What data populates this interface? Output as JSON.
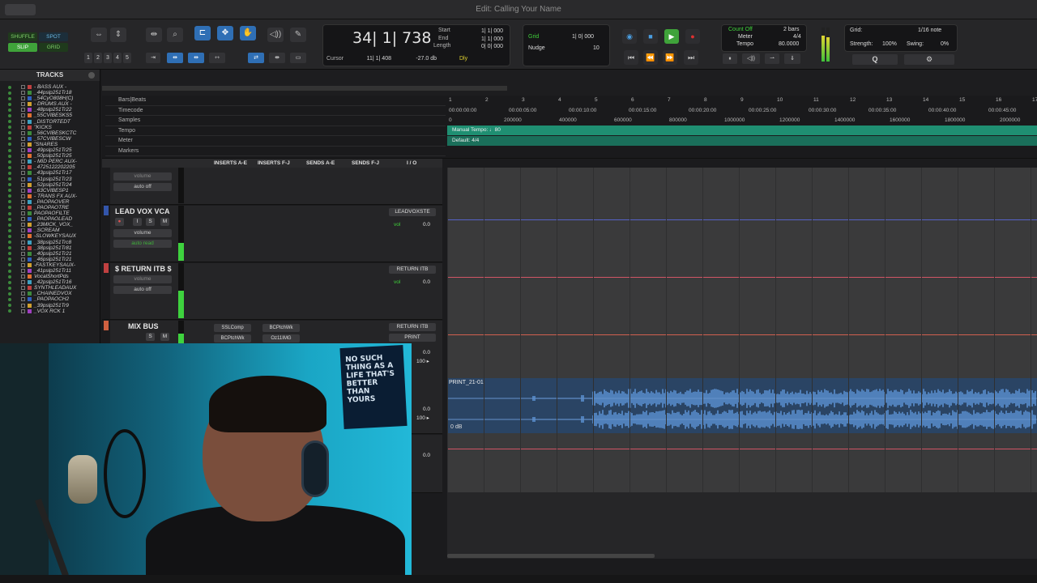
{
  "window": {
    "title": "Edit: Calling Your Name"
  },
  "toolbar": {
    "modes": [
      "SHUFFLE",
      "SPOT",
      "SLIP",
      "GRID"
    ],
    "zoom_presets": [
      "1",
      "2",
      "3",
      "4",
      "5"
    ],
    "counter": {
      "main": "34| 1| 738",
      "start_label": "Start",
      "start": "1| 1| 000",
      "end_label": "End",
      "end": "1| 1| 000",
      "length_label": "Length",
      "length": "0| 0| 000",
      "cursor_label": "Cursor",
      "cursor": "11| 1| 408",
      "level": "-27.0 db",
      "dly": "Dly"
    },
    "grid": {
      "label": "Grid",
      "value": "1| 0| 000"
    },
    "nudge": {
      "label": "Nudge",
      "value": "10"
    },
    "count_off": {
      "label": "Count Off",
      "value": "2 bars"
    },
    "meter": {
      "label": "Meter",
      "value": "4/4"
    },
    "tempo": {
      "label": "Tempo",
      "value": "80.0000"
    },
    "grid_right": {
      "label": "Grid:",
      "value": "1/16 note"
    },
    "strength": {
      "label": "Strength:",
      "value": "100%"
    },
    "swing": {
      "label": "Swing:",
      "value": "0%"
    }
  },
  "tracks_panel": {
    "title": "TRACKS",
    "items": [
      "- BASS AUX -",
      "_44pslp251Tr18",
      "_54CyO808H(C)",
      "- DRUMS AUX -",
      "_48pslp251Tr22",
      "_55CVIBESKS5",
      "_DISTORTEDT",
      "\"KICKS",
      "_56CVIBESKCTC",
      "_57CVIBESCW",
      "\"SNARES",
      "_49pslp251Tr25",
      "_50pslp251Tr25",
      "- MID PERC AUX-",
      "_4725122202205",
      "_43pslp251Tr17",
      "_51pslp251Tr23",
      "_52pslp251Tr24",
      "_63CVIBESP1",
      "- TRANS FX AUX-",
      "_PAOPAOVER",
      "_PAOPAOTRE",
      "PAOPAOFILTE",
      "_PAOPAOLEAD",
      "_23MICK_VOX_",
      "_SCREAM",
      "-SLOWKEYSAUX",
      "_38pslp251Trc8",
      "_38pslp251Tr81",
      "_40pslp251Tr21",
      "_46pslp251Tr21",
      "-FASTKEYSAUX-",
      "_41pslp251Tr11",
      "VocalShortPds",
      "_42pslp251Tr16",
      "SYNTHLEADAUX",
      "_CHAINEDVOX",
      "_PAOPAOCH2",
      "_39pslp251Tr9",
      "_VOX RCK 1"
    ]
  },
  "rulers": {
    "labels": [
      "Bars|Beats",
      "Timecode",
      "Samples",
      "Tempo",
      "Meter",
      "Markers"
    ],
    "bars": [
      "1",
      "2",
      "3",
      "4",
      "5",
      "6",
      "7",
      "8",
      "9",
      "10",
      "11",
      "12",
      "13",
      "14",
      "15",
      "16",
      "17"
    ],
    "timecode": [
      "00:00:00:00",
      "00:00:05:00",
      "00:00:10:00",
      "00:00:15:00",
      "00:00:20:00",
      "00:00:25:00",
      "00:00:30:00",
      "00:00:35:00",
      "00:00:40:00",
      "00:00:45:00"
    ],
    "samples": [
      "0",
      "200000",
      "400000",
      "600000",
      "800000",
      "1000000",
      "1200000",
      "1400000",
      "1600000",
      "1800000",
      "2000000"
    ],
    "tempo_text": "Manual Tempo: ♩80",
    "meter_text": "Default: 4/4"
  },
  "columns": {
    "inserts_ae": "INSERTS A-E",
    "inserts_fj": "INSERTS F-J",
    "sends_ae": "SENDS A-E",
    "sends_fj": "SENDS F-J",
    "io": "I / O"
  },
  "lanes": {
    "top": {
      "automation": "volume",
      "mode": "auto off"
    },
    "lead_vox": {
      "name": "LEAD VOX VCA",
      "automation": "volume",
      "mode": "auto read",
      "io": "LEADVOXSTE",
      "vol_label": "vol",
      "vol": "0.0"
    },
    "return": {
      "name": "$ RETURN ITB $",
      "automation": "volume",
      "mode": "auto off",
      "io": "RETURN ITB",
      "vol_label": "vol",
      "vol": "0.0"
    },
    "mix_bus": {
      "name": "MIX BUS",
      "inserts": [
        "SSLComp",
        "BCPtchWk"
      ],
      "inserts2": [
        "BCPtchWk",
        "Oz11IMG"
      ],
      "io": "RETURN ITB",
      "io2": "PRINT",
      "vol": "0.0",
      "pan": "100 ▸"
    },
    "print": {
      "vol": "0.0",
      "pan": "100 ▸",
      "vol2": "0.0"
    }
  },
  "clip": {
    "name": "PRINT_21-01",
    "gain": "0 dB"
  },
  "webcam": {
    "poster_lines": [
      "NO SUCH",
      "THING AS A",
      "LIFE THAT'S",
      "BETTER THAN",
      "YOURS"
    ]
  },
  "colors": {
    "accent": "#2f6fb5",
    "tempo_ruler": "#1f8f72",
    "clip": "#2a4464",
    "wave": "#5a8fd0",
    "play": "#3fa33a"
  }
}
